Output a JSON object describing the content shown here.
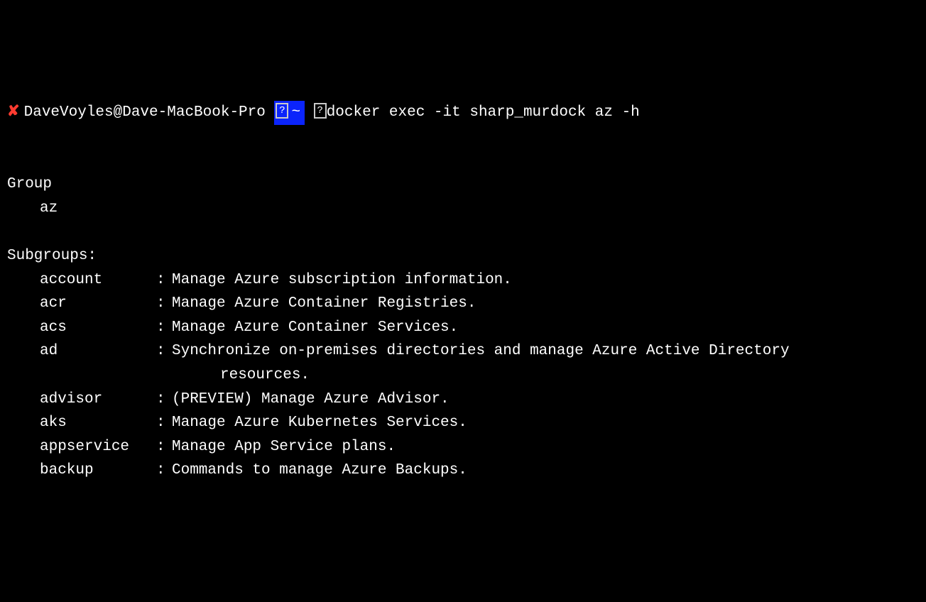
{
  "prompt": {
    "cross": "✘",
    "user_host": "DaveVoyles@Dave-MacBook-Pro",
    "glyph": "?",
    "tilde": "~",
    "command": "docker exec -it sharp_murdock az -h"
  },
  "group": {
    "heading": "Group",
    "name": "az"
  },
  "subgroups": {
    "heading": "Subgroups:",
    "items": [
      {
        "name": "account",
        "desc": "Manage Azure subscription information."
      },
      {
        "name": "acr",
        "desc": "Manage Azure Container Registries."
      },
      {
        "name": "acs",
        "desc": "Manage Azure Container Services."
      },
      {
        "name": "ad",
        "desc": "Synchronize on-premises directories and manage Azure Active Directory",
        "cont": "resources."
      },
      {
        "name": "advisor",
        "desc": "(PREVIEW) Manage Azure Advisor."
      },
      {
        "name": "aks",
        "desc": "Manage Azure Kubernetes Services."
      },
      {
        "name": "appservice",
        "desc": "Manage App Service plans."
      },
      {
        "name": "backup",
        "desc": "Commands to manage Azure Backups."
      }
    ]
  }
}
